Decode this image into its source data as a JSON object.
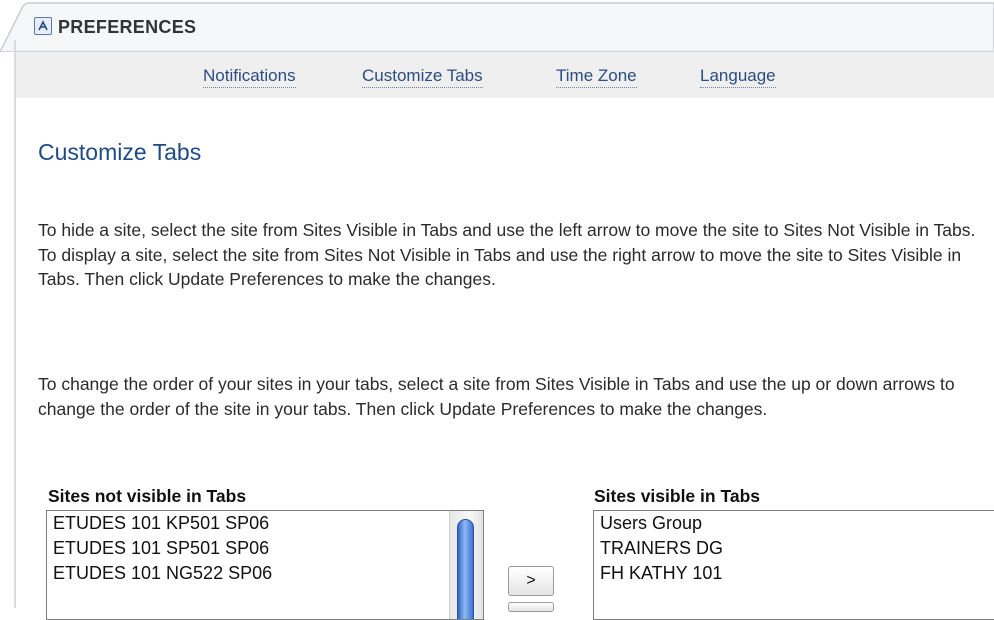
{
  "header": {
    "title": "PREFERENCES",
    "icon": "preferences-icon"
  },
  "nav": {
    "items": [
      "Notifications",
      "Customize Tabs",
      "Time Zone",
      "Language"
    ],
    "link_color": "#2c4d7f"
  },
  "page": {
    "title": "Customize Tabs",
    "title_color": "#1f4a86",
    "paragraph1": "To hide a site, select the site from Sites Visible in Tabs and use the left arrow to move the site to Sites Not Visible in Tabs. To display a site, select the site from Sites Not Visible in Tabs and use the right arrow to move the site to Sites Visible in Tabs. Then click Update Preferences to make the changes.",
    "paragraph2": "To change the order of your sites in your tabs, select a site from Sites Visible in Tabs and use the up or down arrows to change the order of the site in your tabs. Then click Update Preferences to make the changes."
  },
  "lists": {
    "not_visible": {
      "label": "Sites not visible in Tabs",
      "items": [
        "ETUDES 101 KP501 SP06",
        "ETUDES 101 SP501 SP06",
        "ETUDES 101 NG522 SP06"
      ]
    },
    "visible": {
      "label": "Sites visible in Tabs",
      "items": [
        "Users Group",
        "TRAINERS DG",
        "FH KATHY 101"
      ]
    }
  },
  "buttons": {
    "move_right": ">"
  }
}
